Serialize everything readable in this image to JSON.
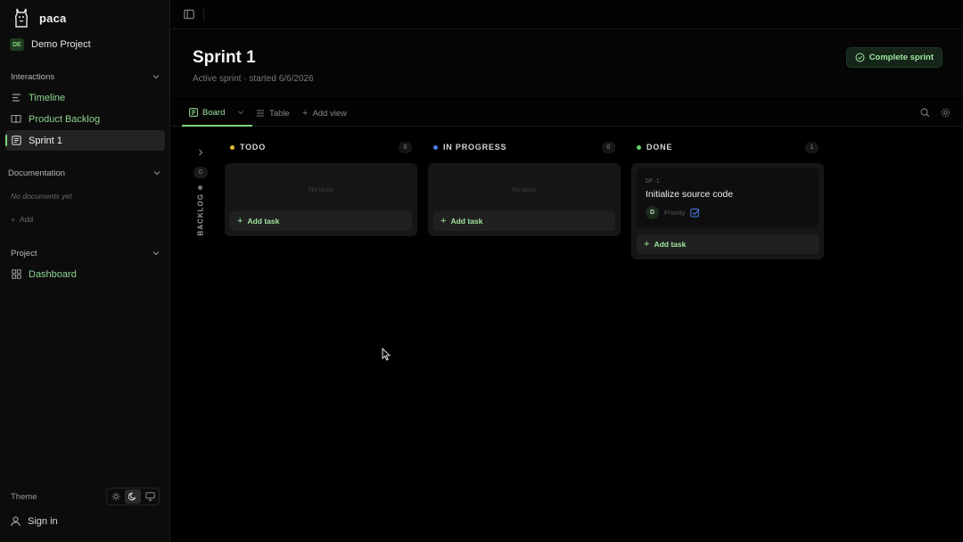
{
  "app": {
    "name": "paca"
  },
  "project": {
    "badge": "DE",
    "name": "Demo Project"
  },
  "sidebar": {
    "interactions": {
      "title": "Interactions",
      "items": [
        {
          "label": "Timeline",
          "icon": "list-icon"
        },
        {
          "label": "Product Backlog",
          "icon": "book-icon"
        },
        {
          "label": "Sprint 1",
          "icon": "board-icon",
          "active": true
        }
      ]
    },
    "documentation": {
      "title": "Documentation",
      "empty": "No documents yet",
      "add_label": "Add"
    },
    "project_group": {
      "title": "Project",
      "items": [
        {
          "label": "Dashboard",
          "icon": "grid-icon"
        }
      ]
    },
    "theme": {
      "label": "Theme",
      "options": [
        "light",
        "dark",
        "system"
      ],
      "selected": "dark"
    },
    "signin": {
      "label": "Sign in"
    }
  },
  "header": {
    "title": "Sprint 1",
    "subtitle": "Active sprint · started 6/6/2026",
    "complete_button": "Complete sprint"
  },
  "tabs": [
    {
      "label": "Board",
      "active": true
    },
    {
      "label": "Table",
      "active": false
    },
    {
      "label": "Add view",
      "active": false
    }
  ],
  "board": {
    "backlog": {
      "label": "BACKLOG",
      "count": "0"
    },
    "columns": [
      {
        "name": "TODO",
        "count": "0",
        "color": "#e8b93a",
        "empty_text": "No tasks",
        "add_label": "Add task"
      },
      {
        "name": "IN PROGRESS",
        "count": "0",
        "color": "#4a7fe8",
        "empty_text": "No tasks",
        "add_label": "Add task"
      },
      {
        "name": "DONE",
        "count": "1",
        "color": "#5fce6a",
        "add_label": "Add task",
        "cards": [
          {
            "key": "DP-1",
            "title": "Initialize source code",
            "assignee": "D",
            "priority": "Priority"
          }
        ]
      }
    ]
  },
  "colors": {
    "accent": "#7ed67e",
    "background": "#000000",
    "sidebar": "#0c0c0c"
  }
}
